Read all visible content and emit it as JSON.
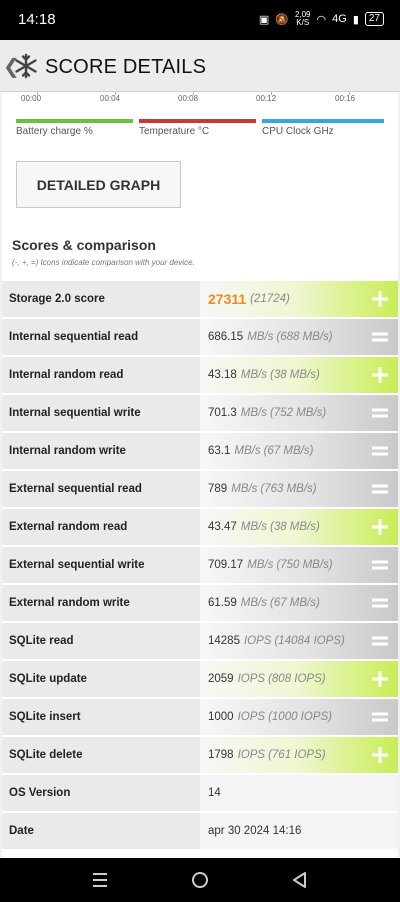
{
  "status": {
    "time": "14:18",
    "speed": "2,09",
    "speed_unit": "K/S",
    "network": "4G",
    "battery": "27"
  },
  "header": {
    "title": "SCORE DETAILS"
  },
  "timeline": {
    "labels": [
      "00:00",
      "00:04",
      "00:08",
      "00:12",
      "00:16"
    ]
  },
  "legend": [
    {
      "label": "Battery charge %",
      "color": "#6cbf3f"
    },
    {
      "label": "Temperature °C",
      "color": "#c9393a"
    },
    {
      "label": "CPU Clock GHz",
      "color": "#3aa5dc"
    }
  ],
  "detail_button": "DETAILED GRAPH",
  "section": {
    "title": "Scores & comparison",
    "subtitle": "(-, +, =) Icons indicate comparison with your device."
  },
  "score": {
    "label": "Storage 2.0 score",
    "value": "27311",
    "compare": "(21724)"
  },
  "rows": [
    {
      "label": "Internal sequential read",
      "value": "686.15",
      "unit": "MB/s",
      "compare": "(688 MB/s)"
    },
    {
      "label": "Internal random read",
      "value": "43.18",
      "unit": "MB/s",
      "compare": "(38 MB/s)"
    },
    {
      "label": "Internal sequential write",
      "value": "701.3",
      "unit": "MB/s",
      "compare": "(752 MB/s)"
    },
    {
      "label": "Internal random write",
      "value": "63.1",
      "unit": "MB/s",
      "compare": "(67 MB/s)"
    },
    {
      "label": "External sequential read",
      "value": "789",
      "unit": "MB/s",
      "compare": "(763 MB/s)"
    },
    {
      "label": "External random read",
      "value": "43.47",
      "unit": "MB/s",
      "compare": "(38 MB/s)"
    },
    {
      "label": "External sequential write",
      "value": "709.17",
      "unit": "MB/s",
      "compare": "(750 MB/s)"
    },
    {
      "label": "External random write",
      "value": "61.59",
      "unit": "MB/s",
      "compare": "(67 MB/s)"
    },
    {
      "label": "SQLite read",
      "value": "14285",
      "unit": "IOPS",
      "compare": "(14084 IOPS)"
    },
    {
      "label": "SQLite update",
      "value": "2059",
      "unit": "IOPS",
      "compare": "(808 IOPS)"
    },
    {
      "label": "SQLite insert",
      "value": "1000",
      "unit": "IOPS",
      "compare": "(1000 IOPS)"
    },
    {
      "label": "SQLite delete",
      "value": "1798",
      "unit": "IOPS",
      "compare": "(761 IOPS)"
    }
  ],
  "info": [
    {
      "label": "OS Version",
      "value": "14"
    },
    {
      "label": "Date",
      "value": "apr 30 2024 14:16"
    }
  ],
  "colors": {
    "score": "#f08a1c",
    "plus_fill": "#c9ed55",
    "equal_fill": "#c9c9c9"
  },
  "icons": {
    "plus": "plus-icon",
    "equal": "equal-icon",
    "logo": "snowflake-icon"
  }
}
